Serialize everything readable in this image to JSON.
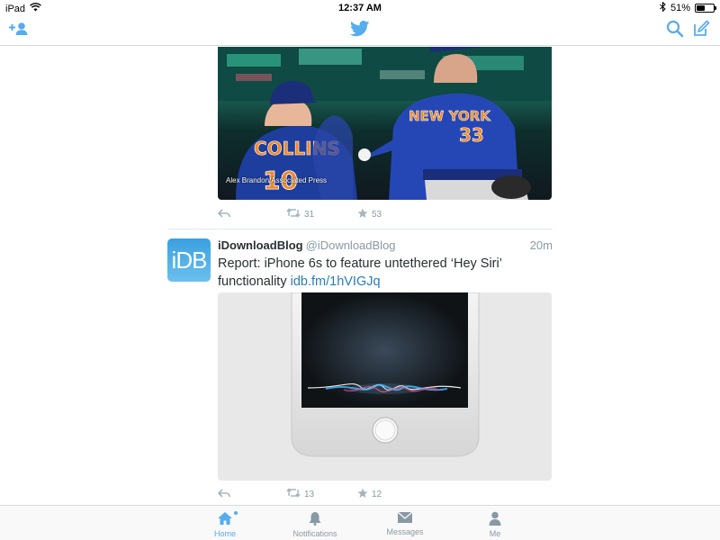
{
  "status_bar": {
    "device": "iPad",
    "time": "12:37 AM",
    "battery": "51%",
    "battery_level": 0.51
  },
  "nav": {
    "add_user_icon": "add-user-icon",
    "logo_icon": "twitter-bird-icon",
    "search_icon": "search-icon",
    "compose_icon": "compose-icon"
  },
  "tweets": [
    {
      "photo_credit": "Alex Brandon/Associated Press",
      "jersey_left": {
        "name": "COLLINS",
        "number": "10"
      },
      "jersey_right": {
        "name": "NEW YORK",
        "number": "33"
      },
      "retweets": "31",
      "favorites": "53"
    },
    {
      "avatar_text": "iDB",
      "name": "iDownloadBlog",
      "handle": "@iDownloadBlog",
      "time": "20m",
      "text": "Report: iPhone 6s to feature untethered ‘Hey Siri’ functionality",
      "link": "idb.fm/1hVIGJq",
      "retweets": "13",
      "favorites": "12"
    }
  ],
  "tabs": [
    {
      "label": "Home",
      "icon": "home-icon",
      "active": true
    },
    {
      "label": "Notifications",
      "icon": "bell-icon",
      "active": false
    },
    {
      "label": "Messages",
      "icon": "envelope-icon",
      "active": false
    },
    {
      "label": "Me",
      "icon": "person-icon",
      "active": false
    }
  ],
  "colors": {
    "accent": "#55acee",
    "muted": "#8899a6",
    "link": "#2b7bb9"
  }
}
